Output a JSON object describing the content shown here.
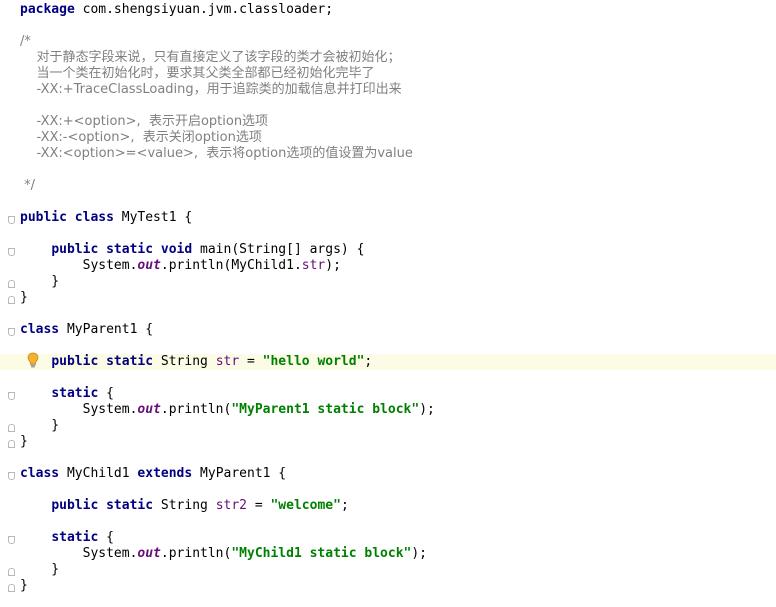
{
  "editor": {
    "language": "java",
    "highlighted_line": 20,
    "colors": {
      "keyword": "#000080",
      "comment": "#808080",
      "string": "#008000",
      "field": "#660e7a",
      "plain": "#000000",
      "current_line": "#fcfbe6",
      "bulb": "#f2b234"
    },
    "lines": [
      {
        "tokens": [
          {
            "t": "kw",
            "v": "package"
          },
          {
            "t": "p",
            "v": " com.shengsiyuan.jvm.classloader;"
          }
        ]
      },
      {
        "tokens": []
      },
      {
        "tokens": [
          {
            "t": "c",
            "v": "/*"
          }
        ]
      },
      {
        "tokens": [
          {
            "t": "c",
            "v": "    对于静态字段来说，只有直接定义了该字段的类才会被初始化；"
          }
        ]
      },
      {
        "tokens": [
          {
            "t": "c",
            "v": "    当一个类在初始化时，要求其父类全部都已经初始化完毕了"
          }
        ]
      },
      {
        "tokens": [
          {
            "t": "c",
            "v": "    -XX:+TraceClassLoading，用于追踪类的加载信息并打印出来"
          }
        ]
      },
      {
        "tokens": []
      },
      {
        "tokens": [
          {
            "t": "c",
            "v": "    -XX:+<option>,  表示开启option选项"
          }
        ]
      },
      {
        "tokens": [
          {
            "t": "c",
            "v": "    -XX:-<option>,  表示关闭option选项"
          }
        ]
      },
      {
        "tokens": [
          {
            "t": "c",
            "v": "    -XX:<option>=<value>,  表示将option选项的值设置为value"
          }
        ]
      },
      {
        "tokens": []
      },
      {
        "tokens": [
          {
            "t": "c",
            "v": " */"
          }
        ]
      },
      {
        "tokens": []
      },
      {
        "tokens": [
          {
            "t": "kw",
            "v": "public class"
          },
          {
            "t": "p",
            "v": " MyTest1 {"
          }
        ]
      },
      {
        "tokens": []
      },
      {
        "tokens": [
          {
            "t": "p",
            "v": "    "
          },
          {
            "t": "kw",
            "v": "public static void"
          },
          {
            "t": "p",
            "v": " main(String[] args) {"
          }
        ]
      },
      {
        "tokens": [
          {
            "t": "p",
            "v": "        System."
          },
          {
            "t": "sf",
            "v": "out"
          },
          {
            "t": "p",
            "v": ".println(MyChild1."
          },
          {
            "t": "f",
            "v": "str"
          },
          {
            "t": "p",
            "v": ");"
          }
        ]
      },
      {
        "tokens": [
          {
            "t": "p",
            "v": "    }"
          }
        ]
      },
      {
        "tokens": [
          {
            "t": "p",
            "v": "}"
          }
        ]
      },
      {
        "tokens": []
      },
      {
        "tokens": [
          {
            "t": "kw",
            "v": "class"
          },
          {
            "t": "p",
            "v": " MyParent1 {"
          }
        ]
      },
      {
        "tokens": []
      },
      {
        "tokens": [
          {
            "t": "p",
            "v": "    "
          },
          {
            "t": "kw",
            "v": "public static"
          },
          {
            "t": "p",
            "v": " String "
          },
          {
            "t": "f",
            "v": "str"
          },
          {
            "t": "p",
            "v": " = "
          },
          {
            "t": "s",
            "v": "\"hello world\""
          },
          {
            "t": "p",
            "v": ";"
          }
        ]
      },
      {
        "tokens": []
      },
      {
        "tokens": [
          {
            "t": "p",
            "v": "    "
          },
          {
            "t": "kw",
            "v": "static"
          },
          {
            "t": "p",
            "v": " {"
          }
        ]
      },
      {
        "tokens": [
          {
            "t": "p",
            "v": "        System."
          },
          {
            "t": "sf",
            "v": "out"
          },
          {
            "t": "p",
            "v": ".println("
          },
          {
            "t": "s",
            "v": "\"MyParent1 static block\""
          },
          {
            "t": "p",
            "v": ");"
          }
        ]
      },
      {
        "tokens": [
          {
            "t": "p",
            "v": "    }"
          }
        ]
      },
      {
        "tokens": [
          {
            "t": "p",
            "v": "}"
          }
        ]
      },
      {
        "tokens": []
      },
      {
        "tokens": [
          {
            "t": "kw",
            "v": "class"
          },
          {
            "t": "p",
            "v": " MyChild1 "
          },
          {
            "t": "kw",
            "v": "extends"
          },
          {
            "t": "p",
            "v": " MyParent1 {"
          }
        ]
      },
      {
        "tokens": []
      },
      {
        "tokens": [
          {
            "t": "p",
            "v": "    "
          },
          {
            "t": "kw",
            "v": "public static"
          },
          {
            "t": "p",
            "v": " String "
          },
          {
            "t": "f",
            "v": "str2"
          },
          {
            "t": "p",
            "v": " = "
          },
          {
            "t": "s",
            "v": "\"welcome\""
          },
          {
            "t": "p",
            "v": ";"
          }
        ]
      },
      {
        "tokens": []
      },
      {
        "tokens": [
          {
            "t": "p",
            "v": "    "
          },
          {
            "t": "kw",
            "v": "static"
          },
          {
            "t": "p",
            "v": " {"
          }
        ]
      },
      {
        "tokens": [
          {
            "t": "p",
            "v": "        System."
          },
          {
            "t": "sf",
            "v": "out"
          },
          {
            "t": "p",
            "v": ".println("
          },
          {
            "t": "s",
            "v": "\"MyChild1 static block\""
          },
          {
            "t": "p",
            "v": ");"
          }
        ]
      },
      {
        "tokens": [
          {
            "t": "p",
            "v": "    }"
          }
        ]
      },
      {
        "tokens": [
          {
            "t": "p",
            "v": "}"
          }
        ]
      }
    ],
    "fold_markers": [
      {
        "line": 13,
        "kind": "open"
      },
      {
        "line": 15,
        "kind": "open"
      },
      {
        "line": 17,
        "kind": "close"
      },
      {
        "line": 18,
        "kind": "close"
      },
      {
        "line": 20,
        "kind": "open"
      },
      {
        "line": 24,
        "kind": "open"
      },
      {
        "line": 26,
        "kind": "close"
      },
      {
        "line": 27,
        "kind": "close"
      },
      {
        "line": 29,
        "kind": "open"
      },
      {
        "line": 33,
        "kind": "open"
      },
      {
        "line": 35,
        "kind": "close"
      },
      {
        "line": 36,
        "kind": "close"
      }
    ],
    "gutter_icons": [
      {
        "line": 22,
        "icon": "intention-bulb-icon"
      }
    ]
  }
}
